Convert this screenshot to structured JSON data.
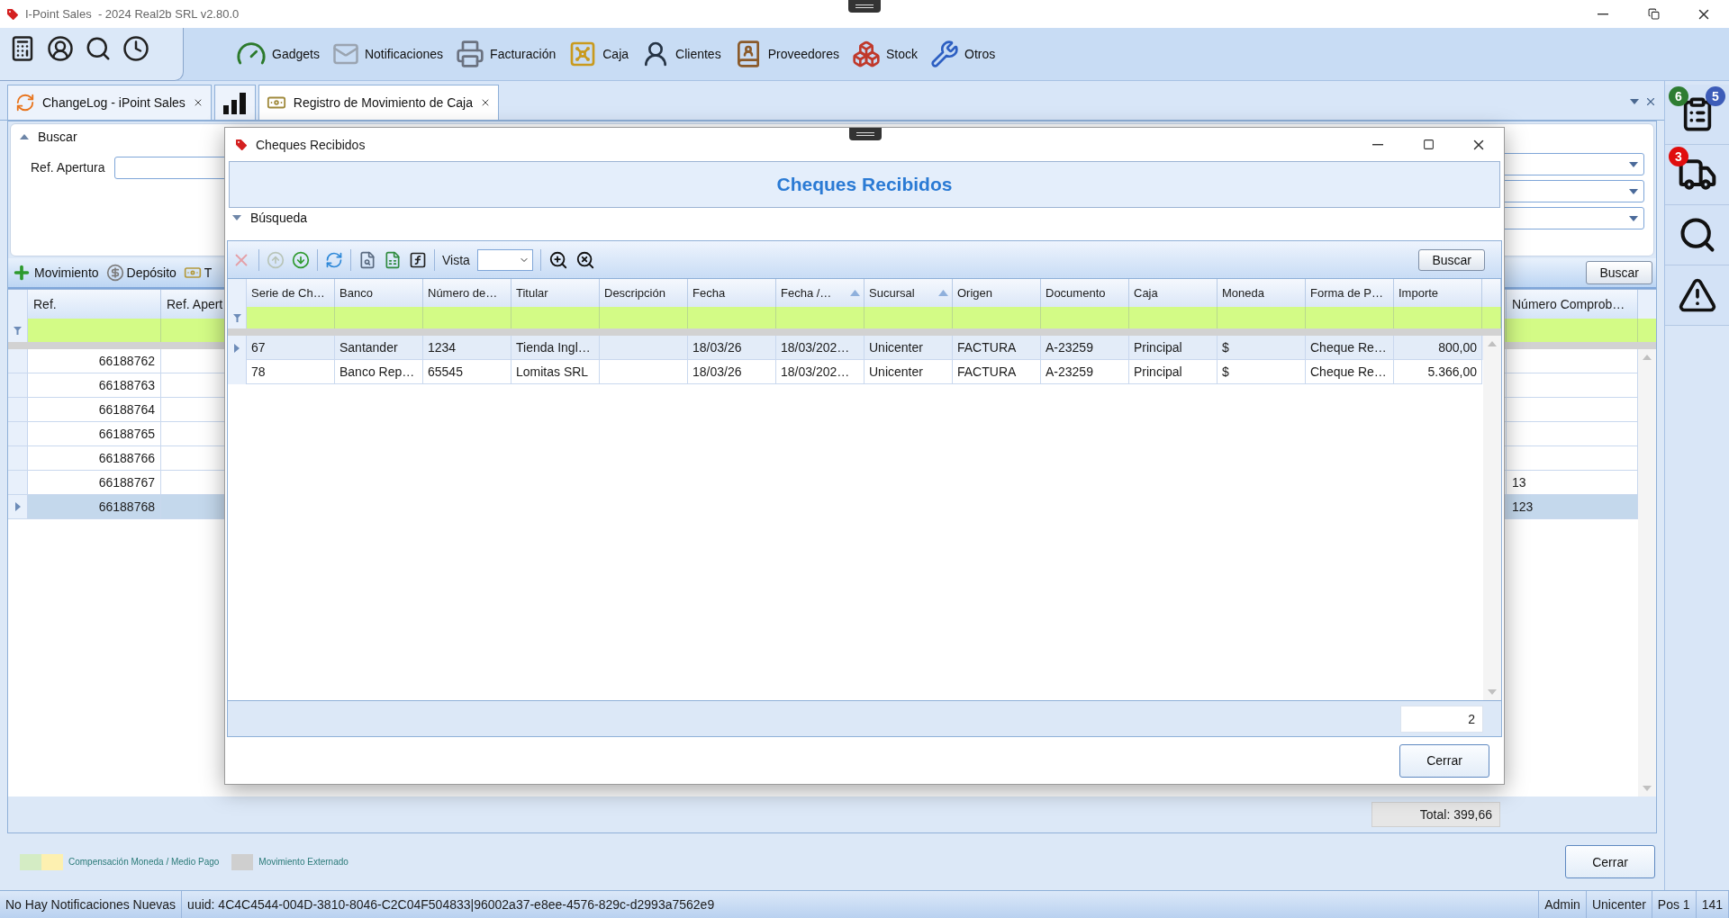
{
  "window": {
    "title": "I-Point Sales  - 2024 Real2b SRL v2.80.0"
  },
  "ribbon": {
    "items": [
      {
        "label": "Gadgets"
      },
      {
        "label": "Notificaciones"
      },
      {
        "label": "Facturación"
      },
      {
        "label": "Caja"
      },
      {
        "label": "Clientes"
      },
      {
        "label": "Proveedores"
      },
      {
        "label": "Stock"
      },
      {
        "label": "Otros"
      }
    ]
  },
  "doc_tabs": [
    {
      "kind": "text",
      "label": "ChangeLog - iPoint Sales",
      "selected": false
    },
    {
      "kind": "chart",
      "selected": false
    },
    {
      "kind": "text",
      "label": "Registro de Movimiento de Caja",
      "selected": true
    }
  ],
  "search_panel": {
    "title": "Buscar",
    "expanded": true,
    "field_label": "Ref. Apertura"
  },
  "grid_toolbar": {
    "buttons": [
      "Movimiento",
      "Depósito",
      "T"
    ],
    "search_button": "Buscar"
  },
  "grid": {
    "columns": [
      "Ref.",
      "Ref. Apert",
      "Número Comprob…"
    ],
    "rows": [
      {
        "ref": "66188762",
        "selected": false
      },
      {
        "ref": "66188763",
        "selected": false
      },
      {
        "ref": "66188764",
        "selected": false
      },
      {
        "ref": "66188765",
        "selected": false
      },
      {
        "ref": "66188766",
        "selected": false
      },
      {
        "ref": "66188767",
        "comprobante": "13",
        "selected": false
      },
      {
        "ref": "66188768",
        "comprobante": "123",
        "selected": true
      }
    ]
  },
  "total": "Total: 399,66",
  "legend": [
    {
      "label": "Compensación Moneda / Medio Pago",
      "swatches": [
        {
          "color": "#d4ecc4"
        },
        {
          "color": "#fdf0b0"
        }
      ]
    },
    {
      "label": "Movimiento Externado",
      "swatches": [
        {
          "color": "#cfcfcf"
        }
      ]
    }
  ],
  "close_button": "Cerrar",
  "side_panel": [
    {
      "kind": "list",
      "badges": [
        {
          "count": "6",
          "color": "#2e7d32"
        },
        {
          "count": "5",
          "color": "#3d5cb8"
        }
      ]
    },
    {
      "kind": "truck",
      "badges": [
        {
          "count": "3",
          "color": "#e00d0d"
        }
      ]
    },
    {
      "kind": "search"
    },
    {
      "kind": "warning"
    }
  ],
  "status_bar": {
    "message": "No Hay Notificaciones Nuevas",
    "uuid": "uuid: 4C4C4544-004D-3810-8046-C2C04F504833|96002a37-e8ee-4576-829c-d2993a7562e9",
    "user": "Admin",
    "branch": "Unicenter",
    "pos": "Pos 1",
    "number": "141"
  },
  "dialog": {
    "title": "Cheques Recibidos",
    "header": "Cheques Recibidos",
    "search_section": {
      "title": "Búsqueda",
      "expanded": false
    },
    "toolbar": {
      "view_label": "Vista",
      "search_button": "Buscar"
    },
    "table": {
      "columns": [
        {
          "label": "Serie de Ch…",
          "sorted": false
        },
        {
          "label": "Banco",
          "sorted": false
        },
        {
          "label": "Número de…",
          "sorted": false
        },
        {
          "label": "Titular",
          "sorted": false
        },
        {
          "label": "Descripción",
          "sorted": false
        },
        {
          "label": "Fecha",
          "sorted": false
        },
        {
          "label": "Fecha /…",
          "sorted": true
        },
        {
          "label": "Sucursal",
          "sorted": true
        },
        {
          "label": "Origen",
          "sorted": false
        },
        {
          "label": "Documento",
          "sorted": false
        },
        {
          "label": "Caja",
          "sorted": false
        },
        {
          "label": "Moneda",
          "sorted": false
        },
        {
          "label": "Forma de P…",
          "sorted": false
        },
        {
          "label": "Importe",
          "sorted": false
        }
      ],
      "rows": [
        {
          "selected": true,
          "cells": [
            "67",
            "Santander",
            "1234",
            "Tienda Ingl…",
            null,
            "18/03/26",
            "18/03/202…",
            "Unicenter",
            "FACTURA",
            "A-23259",
            "Principal",
            "$",
            "Cheque Re…",
            "800,00"
          ]
        },
        {
          "selected": false,
          "cells": [
            "78",
            "Banco Rep…",
            "65545",
            "Lomitas SRL",
            null,
            "18/03/26",
            "18/03/202…",
            "Unicenter",
            "FACTURA",
            "A-23259",
            "Principal",
            "$",
            "Cheque Re…",
            "5.366,00"
          ]
        }
      ]
    },
    "count": "2",
    "close_button": "Cerrar"
  }
}
